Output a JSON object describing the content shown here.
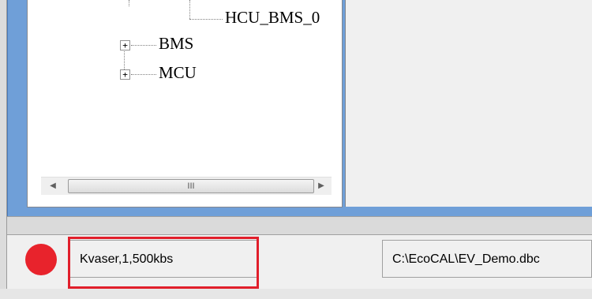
{
  "tree": {
    "items": [
      {
        "label": "HCU_BMS_0",
        "expander": ""
      },
      {
        "label": "BMS",
        "expander": "+"
      },
      {
        "label": "MCU",
        "expander": "+"
      }
    ]
  },
  "scrollbar": {
    "left_arrow": "◀",
    "right_arrow": "▶",
    "thumb_grip": "III"
  },
  "status_bar": {
    "connection_text": "Kvaser,1,500kbs",
    "file_path": "C:\\EcoCAL\\EV_Demo.dbc",
    "status_light_color": "#e8232c",
    "highlight_color": "#e11f2b"
  }
}
